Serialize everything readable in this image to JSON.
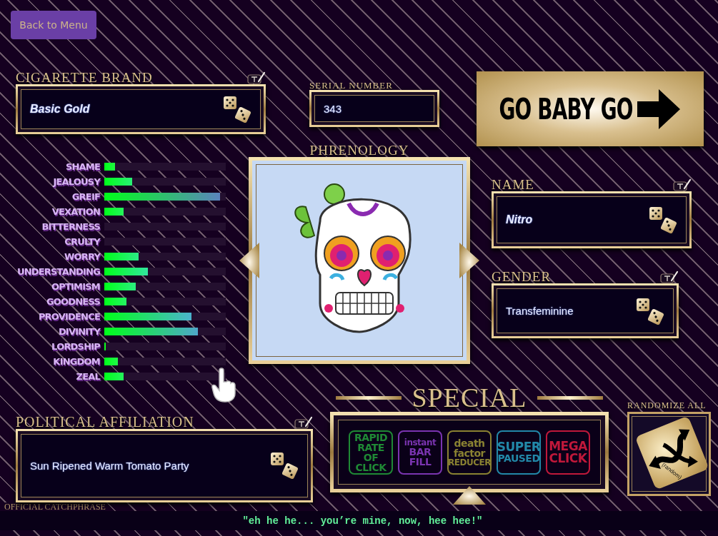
{
  "back_button": "Back to Menu",
  "cigarette_brand": {
    "label": "CIGARETTE BRAND",
    "value": "Basic Gold",
    "emphasis": true
  },
  "serial_number": {
    "label": "SERIAL NUMBER",
    "value": "343"
  },
  "go_button": "GO BABY GO",
  "traits": [
    {
      "name": "SHAME",
      "level": 0.09
    },
    {
      "name": "JEALOUSY",
      "level": 0.23
    },
    {
      "name": "GREIF",
      "level": 0.95
    },
    {
      "name": "VEXATION",
      "level": 0.16
    },
    {
      "name": "BITTERNESS",
      "level": 0
    },
    {
      "name": "CRULTY",
      "level": 0
    },
    {
      "name": "WORRY",
      "level": 0.28
    },
    {
      "name": "UNDERSTANDING",
      "level": 0.36
    },
    {
      "name": "OPTIMISM",
      "level": 0.26
    },
    {
      "name": "GOODNESS",
      "level": 0.18
    },
    {
      "name": "PROVIDENCE",
      "level": 0.72
    },
    {
      "name": "DIVINITY",
      "level": 0.77
    },
    {
      "name": "LORDSHIP",
      "level": 0.01
    },
    {
      "name": "KINGDOM",
      "level": 0.11
    },
    {
      "name": "ZEAL",
      "level": 0.16
    }
  ],
  "phrenology": {
    "title": "PHRENOLOGY"
  },
  "name": {
    "label": "NAME",
    "value": "Nitro",
    "emphasis": true
  },
  "gender": {
    "label": "GENDER",
    "value": "Transfeminine",
    "emphasis": false
  },
  "political_affiliation": {
    "label": "POLITICAL AFFILIATION",
    "value": "Sun Ripened Warm Tomato Party",
    "emphasis": false
  },
  "special": {
    "title": "SPECIAL",
    "powerups": [
      {
        "lines": [
          "RAPID",
          "RATE",
          "OF",
          "CLICK"
        ],
        "color": "#1f8a35"
      },
      {
        "lines": [
          "instant",
          "BAR",
          "FILL"
        ],
        "color": "#7a34b0"
      },
      {
        "lines": [
          "death",
          "factor",
          "REDUCER"
        ],
        "color": "#8a8232"
      },
      {
        "lines": [
          "SUPER",
          "PAUSED"
        ],
        "color": "#2288a8"
      },
      {
        "lines": [
          "MEGA",
          "CLICK"
        ],
        "color": "#c0183a"
      }
    ]
  },
  "randomize_all": {
    "label": "RANDOMIZE ALL",
    "caption": "(random)"
  },
  "catchphrase": {
    "label": "OFFICIAL CATCHPHRASE",
    "value": "\"eh he he... you’re mine, now, hee hee!\""
  }
}
